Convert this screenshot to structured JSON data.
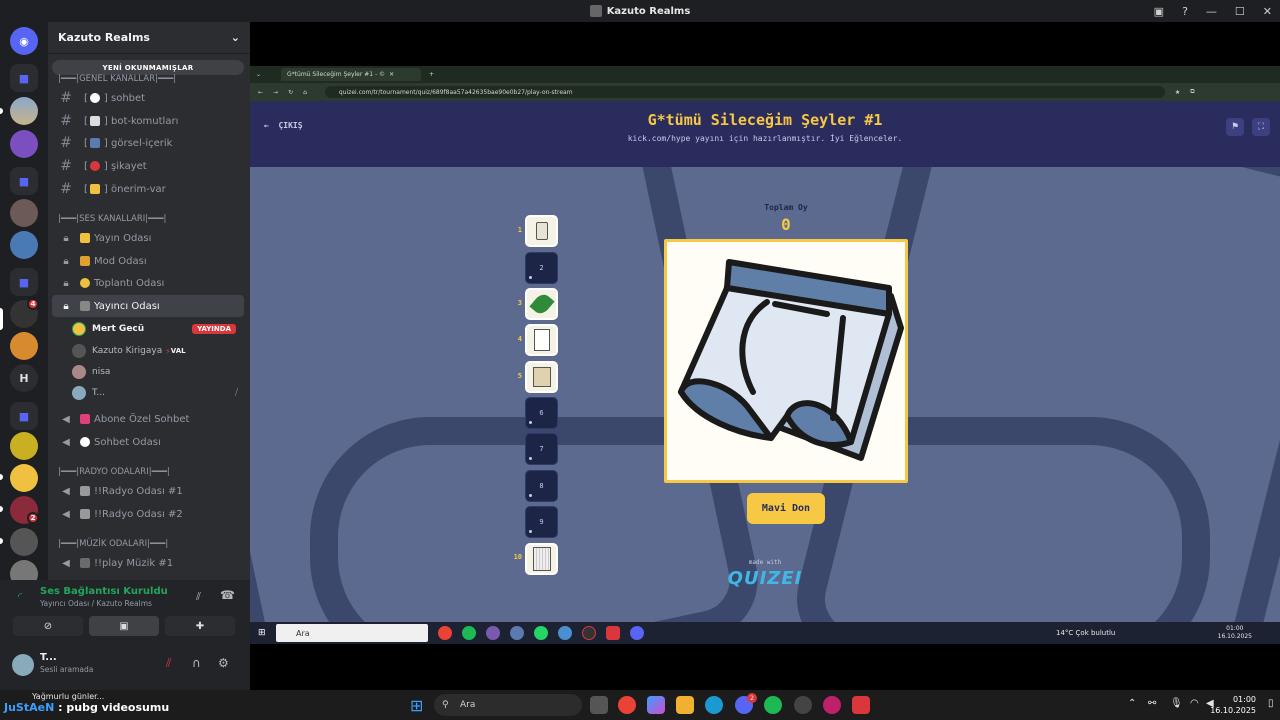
{
  "window": {
    "title": "Kazuto Realms"
  },
  "guild": {
    "name": "Kazuto Realms",
    "unread_banner": "YENİ OKUNMAMIŞLAR",
    "categories": [
      {
        "label": "|━━━|GENEL KANALLAR|━━━|"
      },
      {
        "label": "|━━━|SES KANALLARI|━━━|"
      },
      {
        "label": "|━━━|RADYO ODALARI|━━━|"
      },
      {
        "label": "|━━━|MÜZİK ODALARI|━━━|"
      }
    ],
    "text_channels": [
      {
        "label": "sohbet"
      },
      {
        "label": "bot-komutları"
      },
      {
        "label": "görsel-içerik"
      },
      {
        "label": "şikayet"
      },
      {
        "label": "önerim-var"
      }
    ],
    "voice_channels": [
      {
        "label": "Yayın Odası"
      },
      {
        "label": "Mod Odası"
      },
      {
        "label": "Toplantı Odası"
      },
      {
        "label": "Yayıncı Odası"
      },
      {
        "label": "Abone Özel Sohbet"
      },
      {
        "label": "Sohbet Odası"
      },
      {
        "label": "!!Radyo Odası #1"
      },
      {
        "label": "!!Radyo Odası #2"
      },
      {
        "label": "!!play Müzik #1"
      }
    ],
    "voice_users": [
      {
        "name": "Mert Gecü",
        "badge": "YAYINDA"
      },
      {
        "name": "Kazuto Kirigaya",
        "tag": "VAL"
      },
      {
        "name": "nisa"
      },
      {
        "name": "T..."
      }
    ]
  },
  "voice_panel": {
    "status": "Ses Bağlantısı Kuruldu",
    "location": "Yayıncı Odası / Kazuto Realms"
  },
  "account": {
    "name": "T...",
    "status": "Sesli aramada"
  },
  "server_badges": {
    "b1": "4",
    "b2": "2"
  },
  "browser": {
    "tab_title": "G*tümü Sileceğim Şeyler #1 - ©",
    "url": "quizei.com/tr/tournament/quiz/689f8aa57a42635bae90e0b27/play-on-stream"
  },
  "quiz": {
    "exit_label": "ÇIKIŞ",
    "title": "G*tümü Sileceğim Şeyler #1",
    "subtitle": "kick.com/hype yayını için hazırlanmıştır. İyi Eğlenceler.",
    "total_label": "Toplam Oy",
    "total_value": "0",
    "answer": "Mavi Don",
    "made_with": "made with",
    "logo": "QUIZEI",
    "slots": [
      {
        "number": "1",
        "filled": true,
        "item": "toilet-paper"
      },
      {
        "number": "2",
        "filled": false
      },
      {
        "number": "3",
        "filled": true,
        "item": "leaf"
      },
      {
        "number": "4",
        "filled": true,
        "item": "paper"
      },
      {
        "number": "5",
        "filled": true,
        "item": "shirt"
      },
      {
        "number": "6",
        "filled": false
      },
      {
        "number": "7",
        "filled": false
      },
      {
        "number": "8",
        "filled": false
      },
      {
        "number": "9",
        "filled": false
      },
      {
        "number": "10",
        "filled": true,
        "item": "towel"
      }
    ]
  },
  "streamed_taskbar": {
    "search": "Ara",
    "weather": "14°C  Çok bulutlu",
    "time": "01:00",
    "date": "16.10.2025"
  },
  "taskbar": {
    "news_line1": "Yağmurlu günler...",
    "news_prefix": "JuStAeN",
    "news_line2": ": pubg videosumu",
    "search": "Ara",
    "time": "01:00",
    "date": "16.10.2025",
    "discord_badge": "2"
  },
  "colors": {
    "discord_bg": "#2b2d31",
    "quiz_header": "#2a2c5e",
    "quiz_accent": "#f7c843",
    "live_red": "#da373c",
    "voice_green": "#23a55a"
  }
}
